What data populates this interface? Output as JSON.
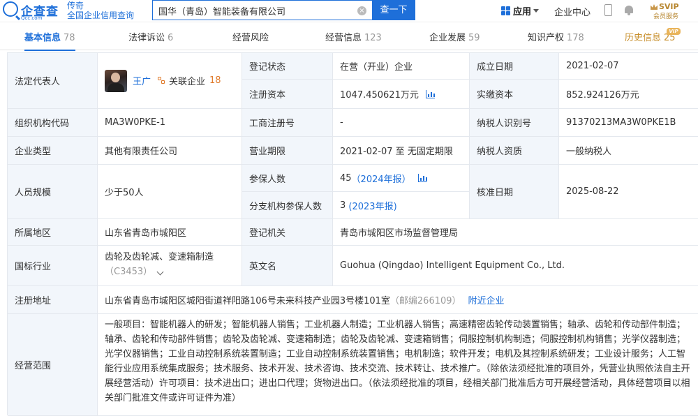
{
  "header": {
    "logo_name": "企查查",
    "logo_domain": "Qcc.com",
    "brand_line1": "传奇",
    "brand_line2": "全国企业信用查询",
    "search_value": "国华（青岛）智能装备有限公司",
    "search_button": "查一下",
    "app_menu": "应用",
    "enterprise_center": "企业中心",
    "svip_line1": "SVIP",
    "svip_line2": "会员服务"
  },
  "tabs": [
    {
      "label": "基本信息",
      "count": "78"
    },
    {
      "label": "法律诉讼",
      "count": "6"
    },
    {
      "label": "经营风险",
      "count": ""
    },
    {
      "label": "经营信息",
      "count": "123"
    },
    {
      "label": "企业发展",
      "count": "59"
    },
    {
      "label": "知识产权",
      "count": "178"
    },
    {
      "label": "历史信息",
      "count": "25"
    }
  ],
  "vip_badge": "VIP",
  "info": {
    "legal_rep_label": "法定代表人",
    "legal_rep_name": "王广",
    "related_label": "关联企业",
    "related_count": "18",
    "reg_status_label": "登记状态",
    "reg_status": "在营（开业）企业",
    "found_date_label": "成立日期",
    "found_date": "2021-02-07",
    "reg_capital_label": "注册资本",
    "reg_capital": "1047.450621万元",
    "paid_capital_label": "实缴资本",
    "paid_capital": "852.924126万元",
    "org_code_label": "组织机构代码",
    "org_code": "MA3W0PKE-1",
    "biz_reg_no_label": "工商注册号",
    "biz_reg_no": "-",
    "taxpayer_id_label": "纳税人识别号",
    "taxpayer_id": "91370213MA3W0PKE1B",
    "company_type_label": "企业类型",
    "company_type": "其他有限责任公司",
    "biz_term_label": "营业期限",
    "biz_term": "2021-02-07 至 无固定期限",
    "taxpayer_qual_label": "纳税人资质",
    "taxpayer_qual": "一般纳税人",
    "staff_size_label": "人员规模",
    "staff_size": "少于50人",
    "insured_label": "参保人数",
    "insured_count": "45",
    "insured_report": "（2024年报）",
    "approval_date_label": "核准日期",
    "approval_date": "2025-08-22",
    "branch_insured_label": "分支机构参保人数",
    "branch_insured_count": "3",
    "branch_insured_report": "(2023年报)",
    "region_label": "所属地区",
    "region": "山东省青岛市城阳区",
    "reg_authority_label": "登记机关",
    "reg_authority": "青岛市城阳区市场监督管理局",
    "industry_label": "国标行业",
    "industry": "齿轮及齿轮减、变速箱制造",
    "industry_code": "（C3453）",
    "english_name_label": "英文名",
    "english_name": "Guohua (Qingdao) Intelligent Equipment Co., Ltd.",
    "address_label": "注册地址",
    "address": "山东省青岛市城阳区城阳街道祥阳路106号未来科技产业园3号楼101室",
    "postcode": "（邮编266109）",
    "nearby_link": "附近企业",
    "scope_label": "经营范围",
    "scope": "一般项目：智能机器人的研发；智能机器人销售；工业机器人制造；工业机器人销售；高速精密齿轮传动装置销售；轴承、齿轮和传动部件制造；轴承、齿轮和传动部件销售；齿轮及齿轮减、变速箱制造；齿轮及齿轮减、变速箱销售；伺服控制机构制造；伺服控制机构销售；光学仪器制造；光学仪器销售；工业自动控制系统装置制造；工业自动控制系统装置销售；电机制造；软件开发；电机及其控制系统研发；工业设计服务；人工智能行业应用系统集成服务；技术服务、技术开发、技术咨询、技术交流、技术转让、技术推广。（除依法须经批准的项目外，凭营业执照依法自主开展经营活动）许可项目：技术进出口；进出口代理；货物进出口。（依法须经批准的项目，经相关部门批准后方可开展经营活动，具体经营项目以相关部门批准文件或许可证件为准）"
  }
}
